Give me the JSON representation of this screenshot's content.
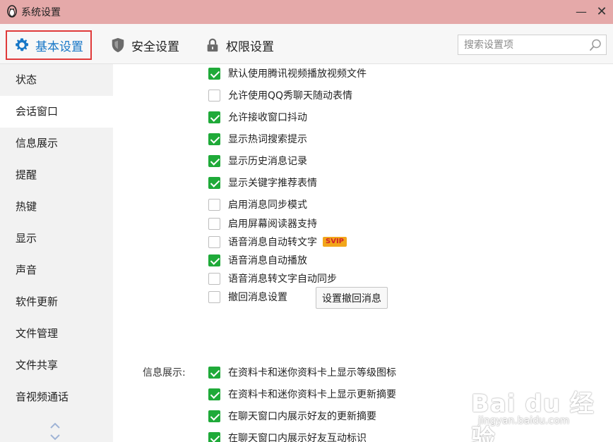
{
  "window": {
    "title": "系统设置",
    "minimize_glyph": "—",
    "close_glyph": "✕"
  },
  "tabs": [
    {
      "label": "基本设置",
      "icon": "gear-icon",
      "active": true
    },
    {
      "label": "安全设置",
      "icon": "shield-icon",
      "active": false
    },
    {
      "label": "权限设置",
      "icon": "lock-icon",
      "active": false
    }
  ],
  "search": {
    "placeholder": "搜索设置项",
    "value": ""
  },
  "sidebar": {
    "items": [
      {
        "label": "状态",
        "active": false
      },
      {
        "label": "会话窗口",
        "active": true
      },
      {
        "label": "信息展示",
        "active": false
      },
      {
        "label": "提醒",
        "active": false
      },
      {
        "label": "热键",
        "active": false
      },
      {
        "label": "显示",
        "active": false
      },
      {
        "label": "声音",
        "active": false
      },
      {
        "label": "软件更新",
        "active": false
      },
      {
        "label": "文件管理",
        "active": false
      },
      {
        "label": "文件共享",
        "active": false
      },
      {
        "label": "音视频通话",
        "active": false
      }
    ]
  },
  "session_options": [
    {
      "label": "默认使用腾讯视频播放视频文件",
      "checked": true
    },
    {
      "label": "允许使用QQ秀聊天随动表情",
      "checked": false
    },
    {
      "label": "允许接收窗口抖动",
      "checked": true
    },
    {
      "label": "显示热词搜索提示",
      "checked": true
    },
    {
      "label": "显示历史消息记录",
      "checked": true
    },
    {
      "label": "显示关键字推荐表情",
      "checked": true
    },
    {
      "label": "启用消息同步模式",
      "checked": false
    },
    {
      "label": "启用屏幕阅读器支持",
      "checked": false
    },
    {
      "label": "语音消息自动转文字",
      "checked": false,
      "badge": "SVIP"
    },
    {
      "label": "语音消息自动播放",
      "checked": true
    },
    {
      "label": "语音消息转文字自动同步",
      "checked": false
    },
    {
      "label": "撤回消息设置",
      "checked": false
    }
  ],
  "recall_button": {
    "label": "设置撤回消息"
  },
  "info_section": {
    "label": "信息展示:",
    "options": [
      {
        "label": "在资料卡和迷你资料卡上显示等级图标",
        "checked": true
      },
      {
        "label": "在资料卡和迷你资料卡上显示更新摘要",
        "checked": true
      },
      {
        "label": "在聊天窗口内展示好友的更新摘要",
        "checked": true
      },
      {
        "label": "在聊天窗口内展示好友互动标识",
        "checked": true
      }
    ]
  },
  "watermark": {
    "logo": "Bai du 经验",
    "sub": "jingyan.baidu.com"
  },
  "colors": {
    "accent": "#1777c7",
    "check": "#1faa39",
    "titlebar": "#e5a9a9",
    "highlight_border": "#e03a3a"
  }
}
